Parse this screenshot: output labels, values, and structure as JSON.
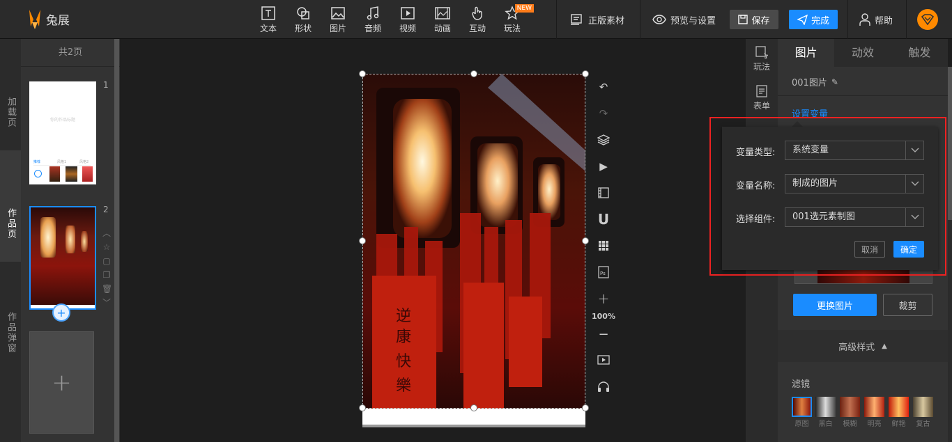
{
  "app": {
    "name": "兔展"
  },
  "toolbar": {
    "tools": [
      {
        "label": "文本",
        "icon": "text-icon"
      },
      {
        "label": "形状",
        "icon": "shape-icon"
      },
      {
        "label": "图片",
        "icon": "image-icon"
      },
      {
        "label": "音频",
        "icon": "music-icon"
      },
      {
        "label": "视频",
        "icon": "video-icon"
      },
      {
        "label": "动画",
        "icon": "animation-icon"
      },
      {
        "label": "互动",
        "icon": "hand-icon"
      },
      {
        "label": "玩法",
        "icon": "star-icon",
        "badge": "NEW"
      }
    ],
    "genuine_assets": "正版素材",
    "preview": "预览与设置",
    "save": "保存",
    "done": "完成",
    "help": "帮助"
  },
  "left_tabs": [
    "加载页",
    "作品页",
    "作品弹窗"
  ],
  "pages": {
    "count_label": "共2页",
    "items": [
      {
        "number": "1",
        "thumb_text": "你的作品标题",
        "labels": [
          "推荐",
          "风格1",
          "风格2"
        ]
      },
      {
        "number": "2"
      }
    ],
    "add_symbol": "+"
  },
  "canvas": {
    "zoom": "100%",
    "zoom_in": "+",
    "zoom_out": "−"
  },
  "right_strip": [
    {
      "label": "玩法",
      "icon": "play-method-icon"
    },
    {
      "label": "表单",
      "icon": "form-icon"
    }
  ],
  "right_panel": {
    "tabs": [
      "图片",
      "动效",
      "触发"
    ],
    "element_name": "001图片",
    "set_variable": "设置变量",
    "replace_image": "更换图片",
    "crop": "裁剪",
    "advanced_style": "高级样式",
    "filter_title": "滤镜",
    "filters": [
      "原图",
      "黑白",
      "模糊",
      "明亮",
      "鲜艳",
      "复古"
    ]
  },
  "popup": {
    "type_label": "变量类型:",
    "type_value": "系统变量",
    "name_label": "变量名称:",
    "name_value": "制成的图片",
    "component_label": "选择组件:",
    "component_value": "001选元素制图",
    "cancel": "取消",
    "confirm": "确定"
  },
  "colors": {
    "accent": "#1a8cff",
    "highlight": "#ee2222",
    "logo": "#ff8a00"
  }
}
